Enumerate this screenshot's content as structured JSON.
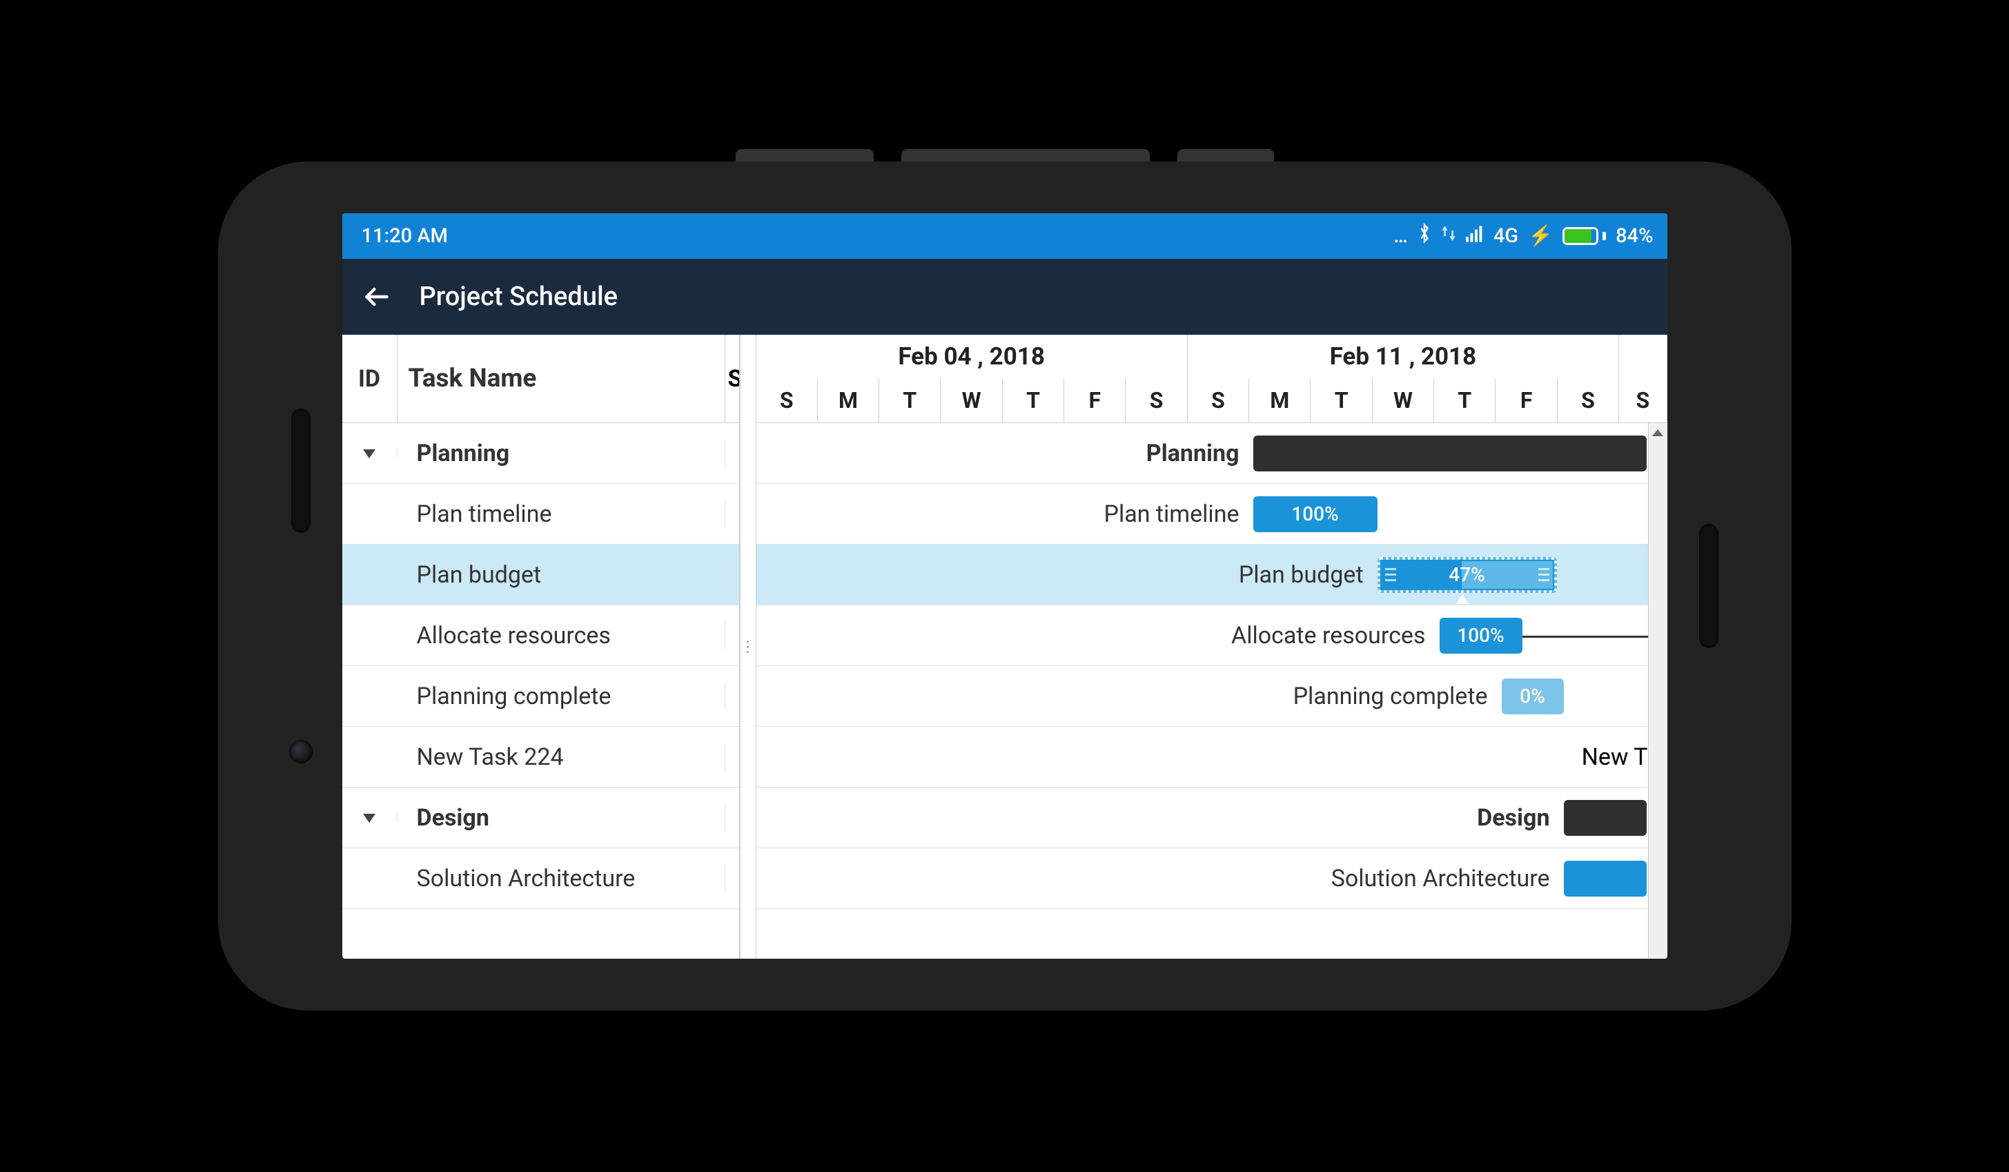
{
  "status": {
    "time": "11:20 AM",
    "more": "…",
    "net": "4G",
    "charge": "⚡",
    "battery": "84%"
  },
  "appbar": {
    "title": "Project Schedule"
  },
  "leftHeader": {
    "id": "ID",
    "name": "Task Name",
    "ext": "S"
  },
  "tasks": [
    {
      "name": "Planning",
      "bold": true,
      "expand": true
    },
    {
      "name": "Plan timeline",
      "bold": false
    },
    {
      "name": "Plan budget",
      "bold": false,
      "selected": true
    },
    {
      "name": "Allocate resources",
      "bold": false
    },
    {
      "name": "Planning complete",
      "bold": false
    },
    {
      "name": "New Task 224",
      "bold": false
    },
    {
      "name": "Design",
      "bold": true,
      "expand": true
    },
    {
      "name": "Solution Architecture",
      "bold": false
    }
  ],
  "weeks": [
    {
      "label": "Feb 04 , 2018",
      "days": [
        "S",
        "M",
        "T",
        "W",
        "T",
        "F",
        "S"
      ]
    },
    {
      "label": "Feb 11 , 2018",
      "days": [
        "S",
        "M",
        "T",
        "W",
        "T",
        "F",
        "S"
      ]
    },
    {
      "label": "",
      "days": [
        "S"
      ]
    }
  ],
  "ganttLabels": {
    "r0": "Planning",
    "r1": "Plan timeline",
    "r2": "Plan budget",
    "r3": "Allocate resources",
    "r4": "Planning complete",
    "r5": "New T",
    "r6": "Design",
    "r7": "Solution Architecture"
  },
  "progress": {
    "r1": "100%",
    "r2": "47%",
    "r3": "100%",
    "r4": "0%"
  },
  "chart_data": {
    "type": "gantt",
    "time_axis": {
      "weeks": [
        "Feb 04 , 2018",
        "Feb 11 , 2018"
      ],
      "day_labels": [
        "S",
        "M",
        "T",
        "W",
        "T",
        "F",
        "S"
      ]
    },
    "tasks": [
      {
        "id": 0,
        "name": "Planning",
        "type": "summary",
        "startDay": 8,
        "visibleToEnd": true
      },
      {
        "id": 1,
        "name": "Plan timeline",
        "type": "task",
        "startDay": 8,
        "endDay": 10,
        "progressPct": 100
      },
      {
        "id": 2,
        "name": "Plan budget",
        "type": "task",
        "startDay": 10,
        "endDay": 13,
        "progressPct": 47,
        "selected": true
      },
      {
        "id": 3,
        "name": "Allocate resources",
        "type": "task",
        "startDay": 11,
        "endDay": 12,
        "progressPct": 100,
        "linkToEndOfRow": true
      },
      {
        "id": 4,
        "name": "Planning complete",
        "type": "milestone",
        "startDay": 12,
        "endDay": 13,
        "progressPct": 0
      },
      {
        "id": 5,
        "name": "New Task 224",
        "type": "task",
        "startDay": 15,
        "labelVisibleOnly": "New T"
      },
      {
        "id": 6,
        "name": "Design",
        "type": "summary",
        "startDay": 13,
        "visibleToEnd": true
      },
      {
        "id": 7,
        "name": "Solution Architecture",
        "type": "task",
        "startDay": 13,
        "visibleToEnd": true
      }
    ]
  }
}
